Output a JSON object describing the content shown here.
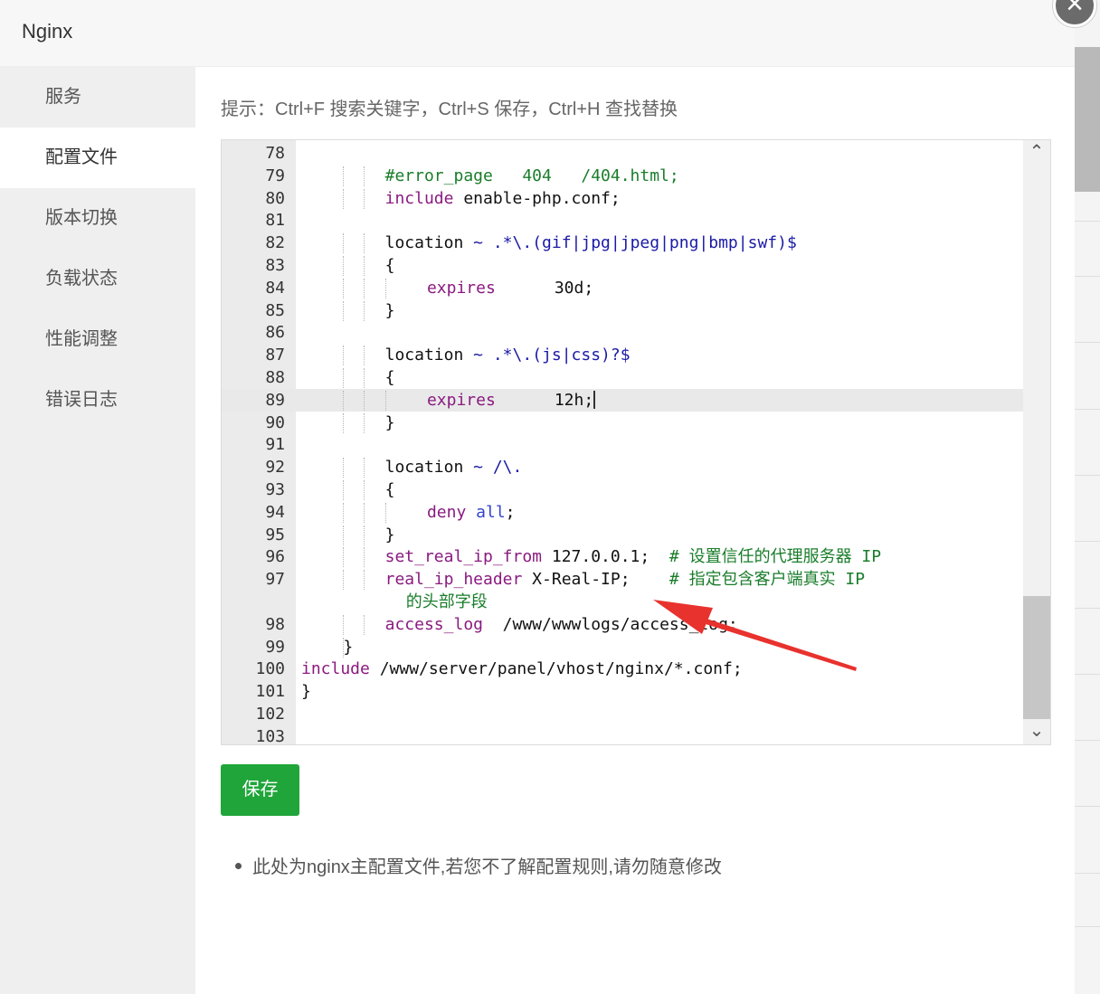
{
  "modal": {
    "title": "Nginx",
    "close_label": "×"
  },
  "sidebar": {
    "items": [
      {
        "label": "服务"
      },
      {
        "label": "配置文件"
      },
      {
        "label": "版本切换"
      },
      {
        "label": "负载状态"
      },
      {
        "label": "性能调整"
      },
      {
        "label": "错误日志"
      }
    ],
    "active_index": 1
  },
  "hint": "提示：Ctrl+F 搜索关键字，Ctrl+S 保存，Ctrl+H 查找替换",
  "editor": {
    "lines": [
      {
        "n": "78"
      },
      {
        "n": "79",
        "text": "#error_page   404   /404.html;"
      },
      {
        "n": "80",
        "kw": "include",
        "text": " enable-php.conf;"
      },
      {
        "n": "81"
      },
      {
        "n": "82",
        "text": "location ~ .*\\.(gif|jpg|jpeg|png|bmp|swf)$"
      },
      {
        "n": "83",
        "text": "{"
      },
      {
        "n": "84",
        "kw": "expires",
        "text": "      30d;"
      },
      {
        "n": "85",
        "text": "}"
      },
      {
        "n": "86"
      },
      {
        "n": "87",
        "text": "location ~ .*\\.(js|css)?$"
      },
      {
        "n": "88",
        "text": "{"
      },
      {
        "n": "89",
        "kw": "expires",
        "text": "      12h;"
      },
      {
        "n": "90",
        "text": "}"
      },
      {
        "n": "91"
      },
      {
        "n": "92",
        "text": "location ~ /\\."
      },
      {
        "n": "93",
        "text": "{"
      },
      {
        "n": "94",
        "kw": "deny",
        "value": "all",
        "text": ";"
      },
      {
        "n": "95",
        "text": "}"
      },
      {
        "n": "96",
        "kw": "set_real_ip_from",
        "text": " 127.0.0.1;  ",
        "comment": "# 设置信任的代理服务器 IP"
      },
      {
        "n": "97",
        "kw": "real_ip_header",
        "text": " X-Real-IP;    ",
        "comment": "# 指定包含客户端真实 IP",
        "comment_wrap": "的头部字段"
      },
      {
        "n": "98",
        "kw": "access_log",
        "text": "  /www/wwwlogs/access_log;"
      },
      {
        "n": "99",
        "text": "}"
      },
      {
        "n": "100",
        "kw": "include",
        "text": " /www/server/panel/vhost/nginx/*.conf;"
      },
      {
        "n": "101",
        "text": "}"
      },
      {
        "n": "102"
      },
      {
        "n": "103"
      }
    ],
    "highlighted_line": "89",
    "scroll_up": "⌃",
    "scroll_down": "⌄"
  },
  "save_button": "保存",
  "note": "此处为nginx主配置文件,若您不了解配置规则,请勿随意修改",
  "colors": {
    "save_button": "#20a53a",
    "keyword": "#8a1a80",
    "comment": "#197d2a",
    "arrow": "#e8322e"
  }
}
